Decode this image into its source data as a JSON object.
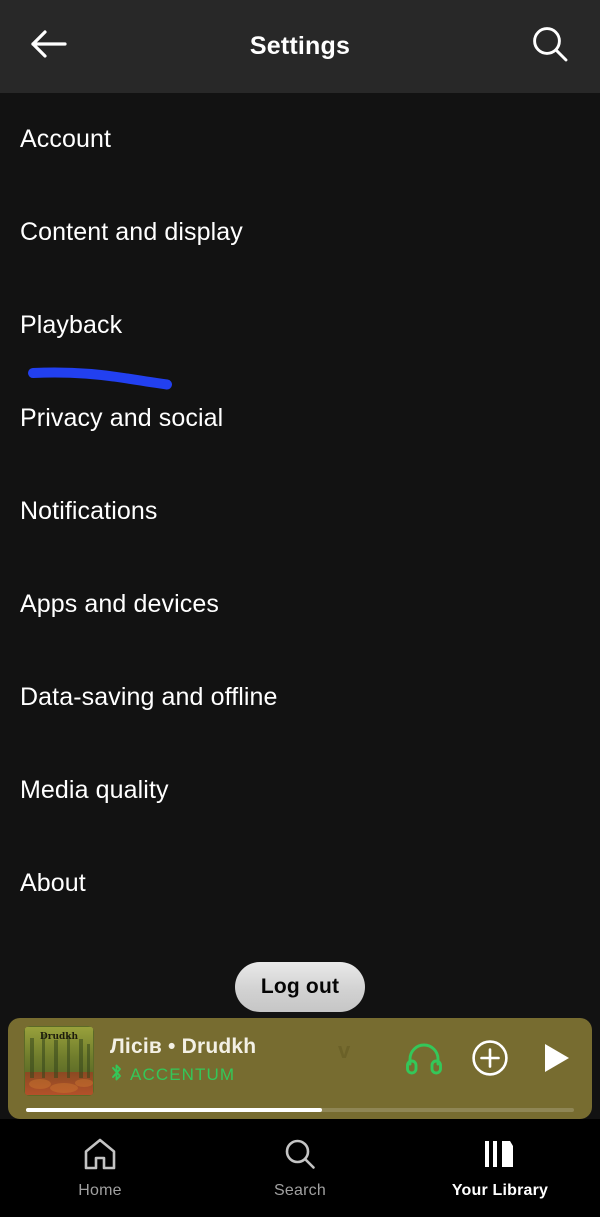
{
  "colors": {
    "page_background": "#121212",
    "header_background": "#282828",
    "accent_green": "#34c759",
    "annotation_blue": "#2240f0",
    "now_playing_background": "#776c30",
    "nav_inactive": "#a0a0a0"
  },
  "header": {
    "title": "Settings",
    "back_icon": "back-arrow-icon",
    "search_icon": "search-icon"
  },
  "settings": {
    "items": [
      {
        "label": "Account"
      },
      {
        "label": "Content and display"
      },
      {
        "label": "Playback"
      },
      {
        "label": "Privacy and social"
      },
      {
        "label": "Notifications"
      },
      {
        "label": "Apps and devices"
      },
      {
        "label": "Data-saving and offline"
      },
      {
        "label": "Media quality"
      },
      {
        "label": "About"
      }
    ],
    "annotation": {
      "target_label": "Playback",
      "shape": "hand-drawn-underline",
      "color": "#2240f0"
    }
  },
  "logout": {
    "label": "Log out"
  },
  "now_playing": {
    "title": "Лісів • Drudkh",
    "overflow_glyph": "v",
    "device_name": "ACCENTUM",
    "bluetooth_icon": "bluetooth-icon",
    "album_art_alt": "album-art",
    "controls": [
      {
        "name": "connect-to-device-button",
        "icon": "headphones-icon"
      },
      {
        "name": "add-to-library-button",
        "icon": "circle-plus-icon"
      },
      {
        "name": "play-button",
        "icon": "play-icon"
      }
    ],
    "progress_percent": 54
  },
  "bottom_nav": {
    "items": [
      {
        "label": "Home",
        "icon": "home-icon",
        "active": false
      },
      {
        "label": "Search",
        "icon": "search-icon",
        "active": false
      },
      {
        "label": "Your Library",
        "icon": "library-icon",
        "active": true
      }
    ]
  }
}
